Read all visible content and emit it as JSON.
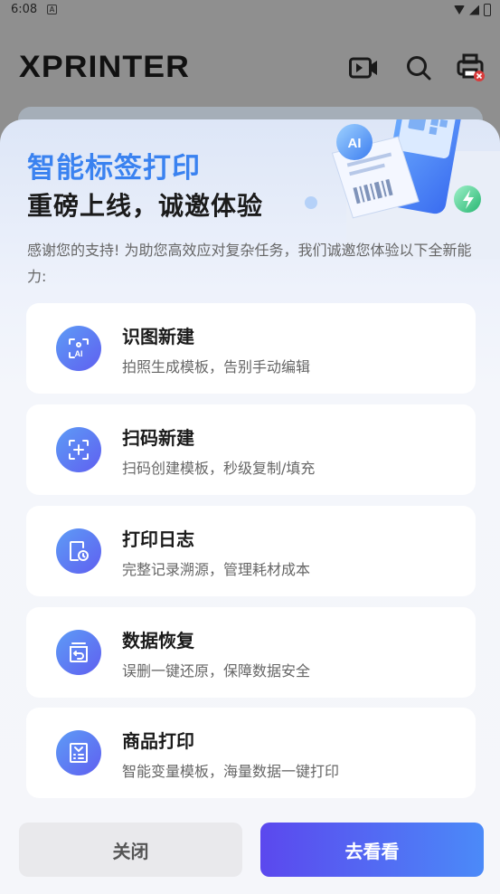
{
  "status_bar": {
    "time": "6:08",
    "app_badge": "A"
  },
  "app": {
    "brand": "XPRINTER"
  },
  "modal": {
    "title": "智能标签打印",
    "subtitle": "重磅上线，诚邀体验",
    "description": "感谢您的支持! 为助您高效应对复杂任务，我们诚邀您体验以下全新能力:",
    "illustration_badge": "AI",
    "features": [
      {
        "title": "识图新建",
        "subtitle": "拍照生成模板，告别手动编辑",
        "icon": "ai-scan-icon"
      },
      {
        "title": "扫码新建",
        "subtitle": "扫码创建模板，秒级复制/填充",
        "icon": "scan-plus-icon"
      },
      {
        "title": "打印日志",
        "subtitle": "完整记录溯源，管理耗材成本",
        "icon": "print-log-icon"
      },
      {
        "title": "数据恢复",
        "subtitle": "误删一键还原，保障数据安全",
        "icon": "restore-icon"
      },
      {
        "title": "商品打印",
        "subtitle": "智能变量模板，海量数据一键打印",
        "icon": "product-print-icon"
      }
    ],
    "close_label": "关闭",
    "go_label": "去看看"
  },
  "colors": {
    "accent_blue": "#3a82f0",
    "button_gradient_start": "#5b48ee",
    "button_gradient_end": "#4b8af8"
  }
}
